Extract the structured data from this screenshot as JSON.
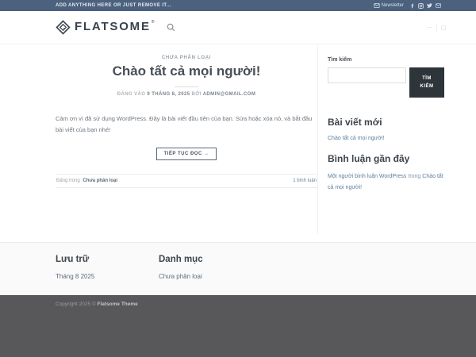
{
  "topbar": {
    "message": "ADD ANYTHING HERE OR JUST REMOVE IT...",
    "newsletter_label": "Newsletter",
    "social_icons": [
      "facebook",
      "instagram",
      "twitter",
      "email"
    ]
  },
  "header": {
    "logo_text": "FLATSOME",
    "logo_reg": "®",
    "search_icon": "magnifier-icon"
  },
  "post": {
    "category": "CHƯA PHÂN LOẠI",
    "title": "Chào tất cả mọi người!",
    "meta": {
      "prefix": "ĐĂNG VÀO",
      "date": "9 THÁNG 8, 2025",
      "by_label": "BỞI",
      "author": "ADMIN@GMAIL.COM"
    },
    "excerpt": "Cảm ơn vì đã sử dụng WordPress. Đây là bài viết đầu tiên của bạn. Sửa hoặc xóa nó, và bắt đầu bài viết của bạn nhé!",
    "read_more_label": "TIẾP TỤC ĐỌC →",
    "posted_in_label": "Đăng trong",
    "posted_in_category": "Chưa phân loại",
    "comments_label": "1 bình luận"
  },
  "sidebar": {
    "search": {
      "label": "Tìm kiếm",
      "input_value": "",
      "button_label": "TÌM KIẾM"
    },
    "recent_posts": {
      "title": "Bài viết mới",
      "items": [
        "Chào tất cả mọi người!"
      ]
    },
    "recent_comments": {
      "title": "Bình luận gần đây",
      "items": [
        {
          "author": "Một người bình luận WordPress",
          "in_label": "trong",
          "post": "Chào tất cả mọi người!"
        }
      ]
    }
  },
  "footer": {
    "archives": {
      "title": "Lưu trữ",
      "items": [
        "Tháng 8 2025"
      ]
    },
    "categories": {
      "title": "Danh mục",
      "items": [
        "Chưa phân loại"
      ]
    },
    "copyright": {
      "prefix": "Copyright 2025 ©",
      "brand": "Flatsome Theme"
    }
  },
  "colors": {
    "topbar_bg": "#4b617d",
    "search_button_bg": "#2d343a",
    "sidebar_link": "#5e7c99",
    "dark_footer_bg": "#58585a",
    "logo_color": "#39424c"
  }
}
